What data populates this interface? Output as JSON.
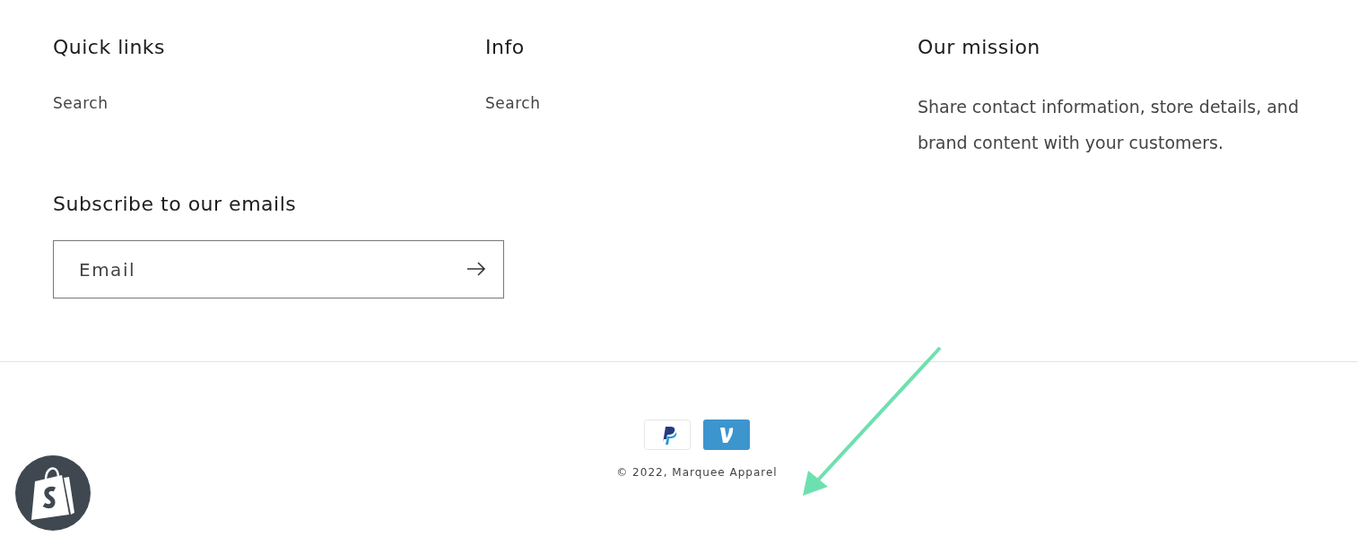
{
  "footer_columns": [
    {
      "heading": "Quick links",
      "links": [
        "Search"
      ]
    },
    {
      "heading": "Info",
      "links": [
        "Search"
      ]
    },
    {
      "heading": "Our mission",
      "text": "Share contact information, store details, and brand content with your customers."
    }
  ],
  "newsletter": {
    "heading": "Subscribe to our emails",
    "placeholder": "Email"
  },
  "payment_icons": [
    {
      "kind": "p"
    },
    {
      "kind": "v"
    }
  ],
  "copyright": "© 2022, Marquee Apparel"
}
